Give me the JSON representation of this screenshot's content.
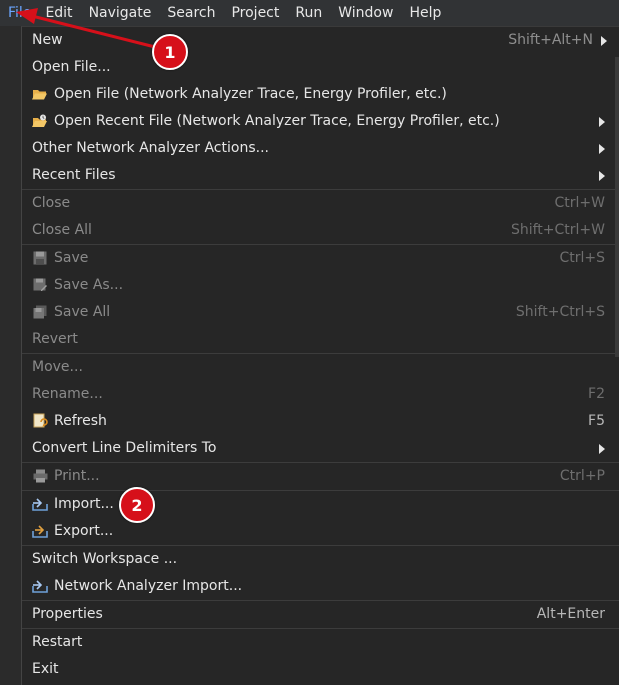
{
  "menubar": {
    "items": [
      "File",
      "Edit",
      "Navigate",
      "Search",
      "Project",
      "Run",
      "Window",
      "Help"
    ]
  },
  "file_menu": {
    "items": [
      {
        "label": "New",
        "shortcut": "Shift+Alt+N",
        "submenu": true,
        "enabled": true
      },
      {
        "label": "Open File...",
        "shortcut": "",
        "enabled": true
      },
      {
        "label": "Open File (Network Analyzer Trace, Energy Profiler, etc.)",
        "shortcut": "",
        "enabled": true,
        "icon": "folder-open-icon"
      },
      {
        "label": "Open Recent File (Network Analyzer Trace, Energy Profiler, etc.)",
        "shortcut": "",
        "submenu": true,
        "enabled": true,
        "icon": "folder-recent-icon"
      },
      {
        "label": "Other Network Analyzer Actions...",
        "shortcut": "",
        "submenu": true,
        "enabled": true
      },
      {
        "label": "Recent Files",
        "shortcut": "",
        "submenu": true,
        "enabled": true
      },
      {
        "label": "Close",
        "shortcut": "Ctrl+W",
        "enabled": false
      },
      {
        "label": "Close All",
        "shortcut": "Shift+Ctrl+W",
        "enabled": false
      },
      {
        "label": "Save",
        "shortcut": "Ctrl+S",
        "enabled": false,
        "icon": "save-icon"
      },
      {
        "label": "Save As...",
        "shortcut": "",
        "enabled": false,
        "icon": "save-as-icon"
      },
      {
        "label": "Save All",
        "shortcut": "Shift+Ctrl+S",
        "enabled": false,
        "icon": "save-all-icon"
      },
      {
        "label": "Revert",
        "shortcut": "",
        "enabled": false
      },
      {
        "label": "Move...",
        "shortcut": "",
        "enabled": false
      },
      {
        "label": "Rename...",
        "shortcut": "F2",
        "enabled": false
      },
      {
        "label": "Refresh",
        "shortcut": "F5",
        "enabled": true,
        "icon": "refresh-icon"
      },
      {
        "label": "Convert Line Delimiters To",
        "shortcut": "",
        "submenu": true,
        "enabled": true
      },
      {
        "label": "Print...",
        "shortcut": "Ctrl+P",
        "enabled": false,
        "icon": "print-icon"
      },
      {
        "label": "Import...",
        "shortcut": "",
        "enabled": true,
        "icon": "import-icon"
      },
      {
        "label": "Export...",
        "shortcut": "",
        "enabled": true,
        "icon": "export-icon"
      },
      {
        "label": "Switch Workspace ...",
        "shortcut": "",
        "enabled": true
      },
      {
        "label": "Network Analyzer Import...",
        "shortcut": "",
        "enabled": true,
        "icon": "network-import-icon"
      },
      {
        "label": "Properties",
        "shortcut": "Alt+Enter",
        "enabled": true
      },
      {
        "label": "Restart",
        "shortcut": "",
        "enabled": true
      },
      {
        "label": "Exit",
        "shortcut": "",
        "enabled": true
      }
    ]
  },
  "annotations": {
    "badge1": "1",
    "badge2": "2",
    "color": "#d6101a"
  },
  "colors": {
    "menubar_bg": "#313335",
    "menu_bg": "#262626",
    "active_menu_text": "#6aa6ff",
    "disabled_text": "#8a8a8a"
  }
}
